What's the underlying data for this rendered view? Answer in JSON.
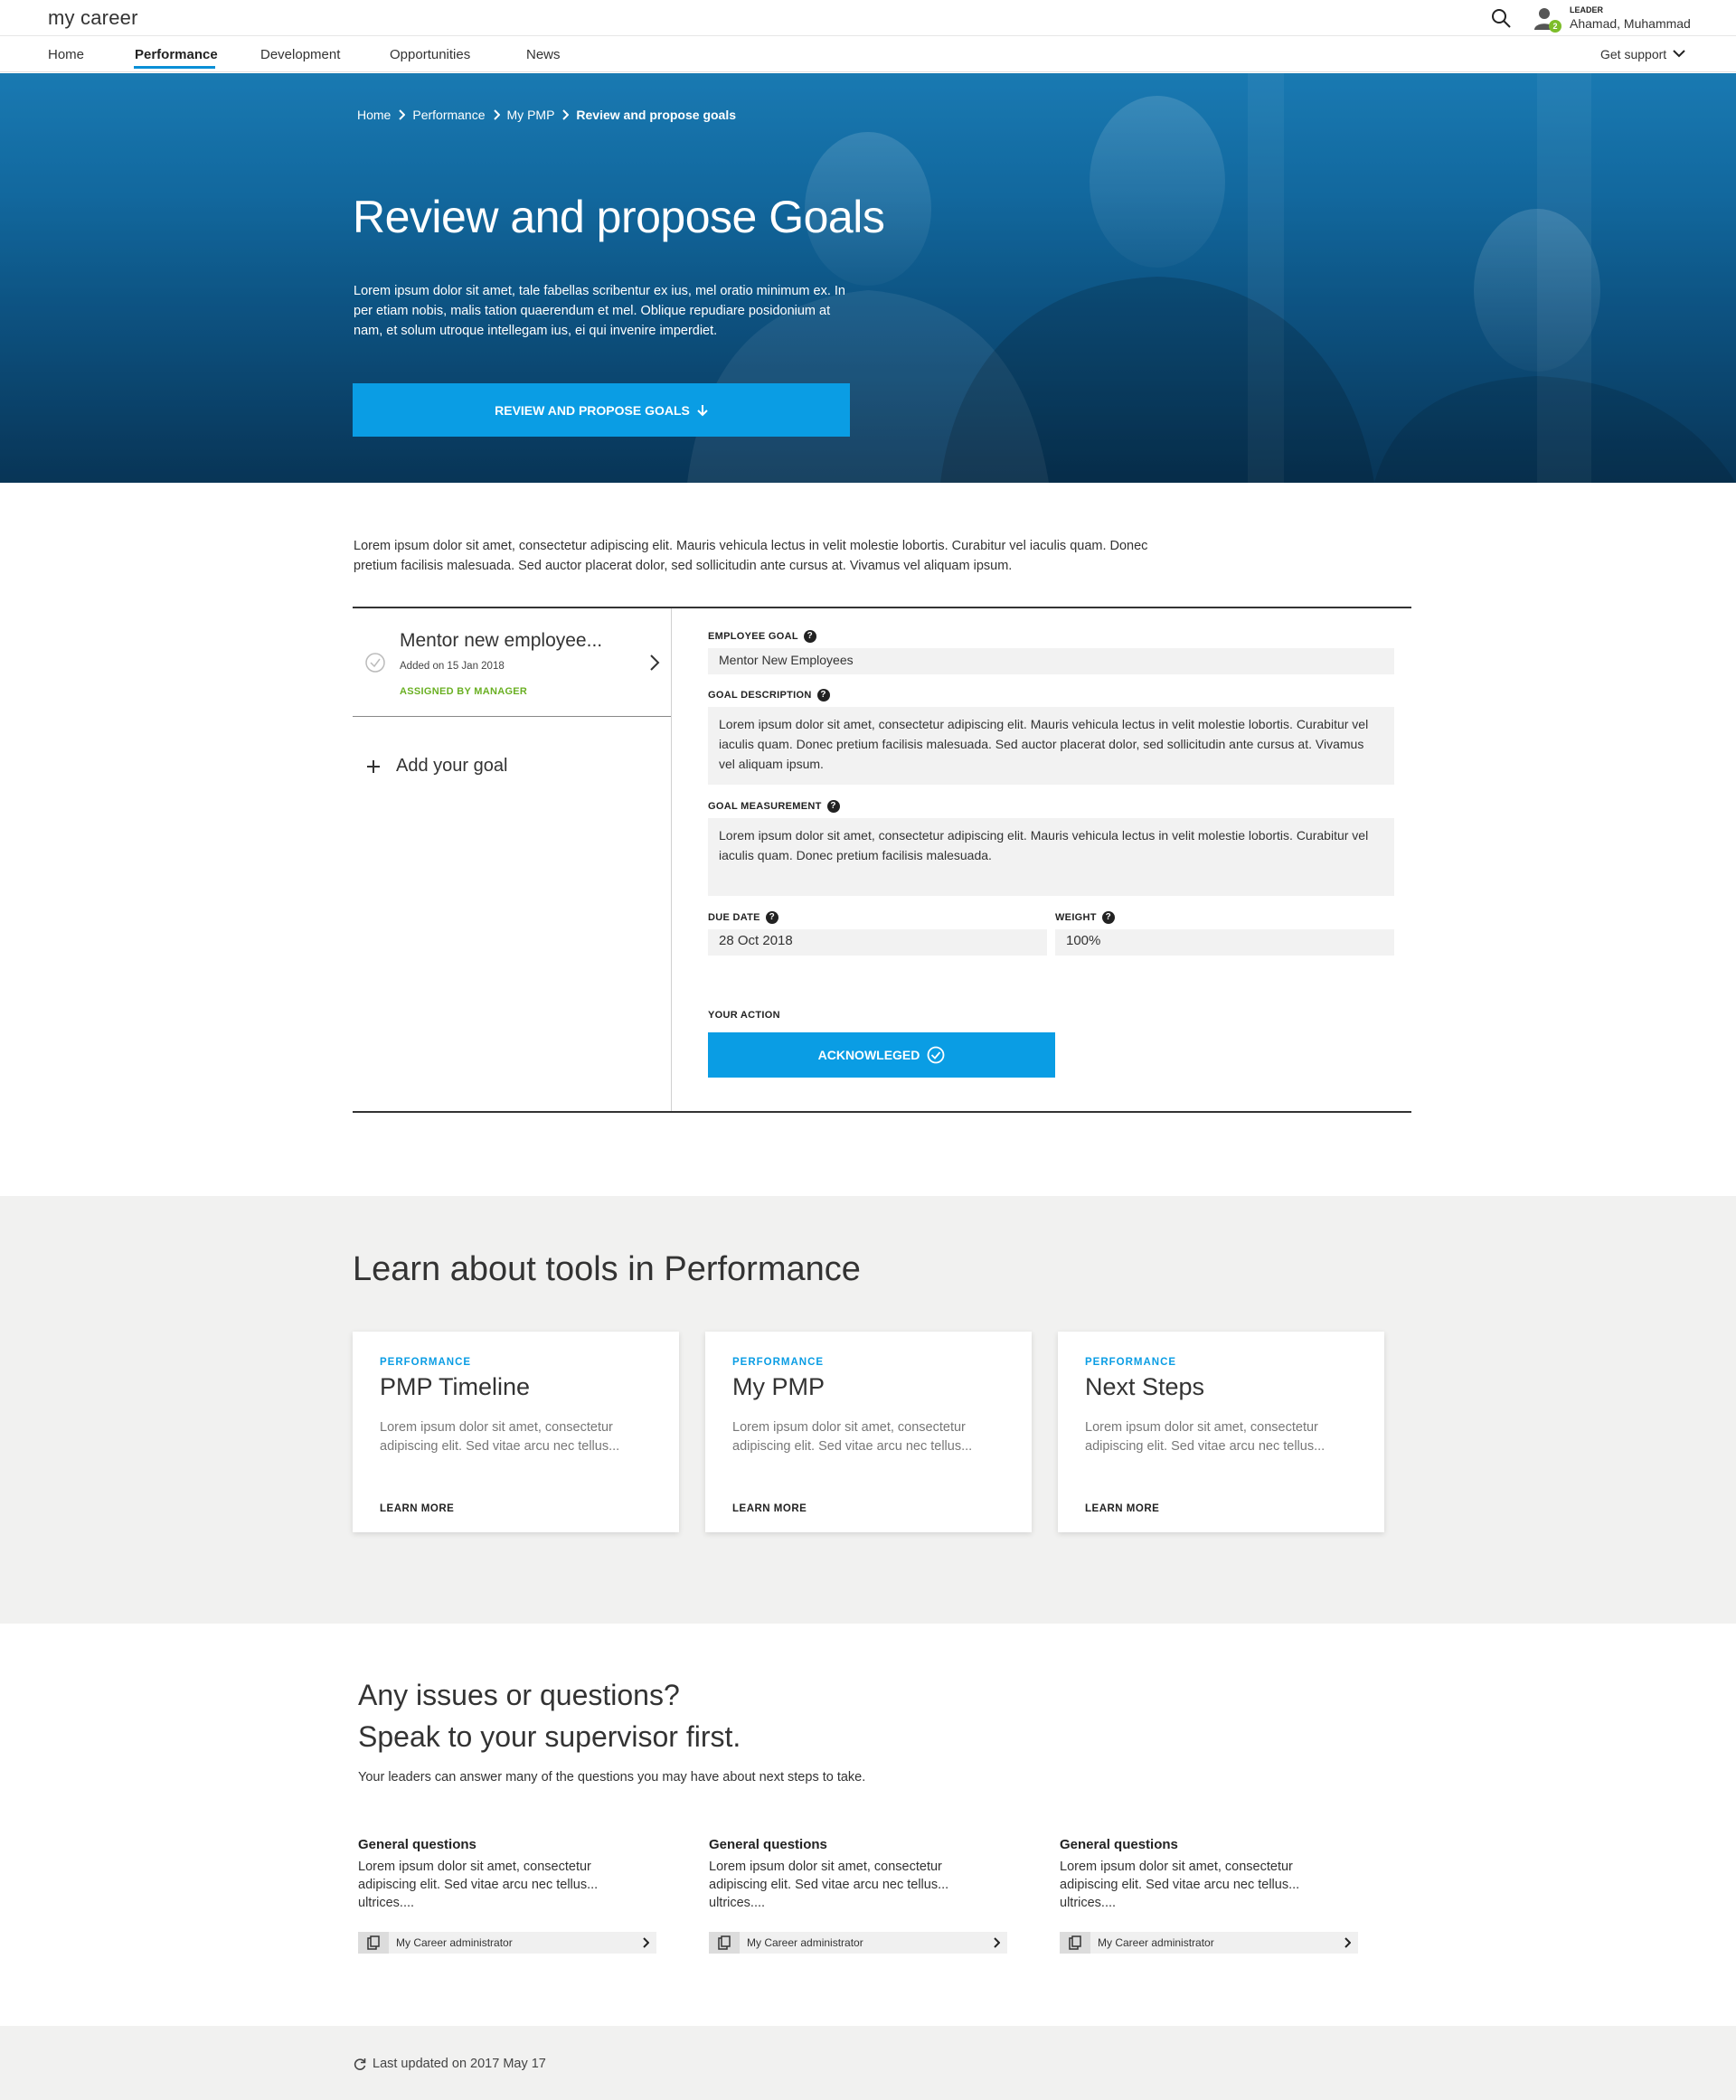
{
  "header": {
    "brand": "my career",
    "role": "LEADER",
    "user_name": "Ahamad, Muhammad",
    "notification_count": "2"
  },
  "nav": {
    "items": [
      "Home",
      "Performance",
      "Development",
      "Opportunities",
      "News"
    ],
    "active": "Performance",
    "support": "Get support"
  },
  "hero": {
    "breadcrumb": [
      "Home",
      "Performance",
      "My PMP",
      "Review and propose goals"
    ],
    "title": "Review and propose Goals",
    "description": "Lorem ipsum dolor sit amet, tale fabellas scribentur ex ius, mel oratio minimum ex. In per etiam nobis, malis tation quaerendum et mel. Oblique repudiare posidonium at nam, et solum utroque intellegam ius, ei qui invenire imperdiet.",
    "button": "REVIEW AND PROPOSE GOALS"
  },
  "intro": "Lorem ipsum dolor sit amet, consectetur adipiscing elit. Mauris vehicula lectus in velit molestie lobortis. Curabitur vel iaculis quam. Donec pretium facilisis malesuada. Sed auctor placerat dolor, sed sollicitudin ante cursus at. Vivamus vel aliquam ipsum.",
  "goals": {
    "list": [
      {
        "title": "Mentor new employee...",
        "added": "Added on 15 Jan 2018",
        "status": "ASSIGNED BY MANAGER"
      }
    ],
    "add_label": "Add your goal",
    "detail": {
      "employee_goal_label": "EMPLOYEE GOAL",
      "employee_goal": "Mentor New Employees",
      "description_label": "GOAL DESCRIPTION",
      "description": "Lorem ipsum dolor sit amet, consectetur adipiscing elit. Mauris vehicula lectus in velit molestie lobortis. Curabitur vel iaculis quam. Donec pretium facilisis malesuada. Sed auctor placerat dolor, sed sollicitudin ante cursus at. Vivamus vel aliquam ipsum.",
      "measurement_label": "GOAL MEASUREMENT",
      "measurement": "Lorem ipsum dolor sit amet, consectetur adipiscing elit. Mauris vehicula lectus in velit molestie lobortis. Curabitur vel iaculis quam. Donec pretium facilisis malesuada.",
      "due_date_label": "DUE DATE",
      "due_date": "28 Oct 2018",
      "weight_label": "WEIGHT",
      "weight": "100%",
      "action_label": "YOUR ACTION",
      "action_button": "ACKNOWLEGED"
    }
  },
  "learn": {
    "title": "Learn about tools in Performance",
    "cards": [
      {
        "kicker": "PERFORMANCE",
        "title": "PMP Timeline",
        "desc": "Lorem ipsum dolor sit amet, consectetur adipiscing elit. Sed vitae arcu nec tellus...",
        "more": "LEARN MORE"
      },
      {
        "kicker": "PERFORMANCE",
        "title": "My PMP",
        "desc": "Lorem ipsum dolor sit amet, consectetur adipiscing elit. Sed vitae arcu nec tellus...",
        "more": "LEARN MORE"
      },
      {
        "kicker": "PERFORMANCE",
        "title": "Next Steps",
        "desc": "Lorem ipsum dolor sit amet, consectetur adipiscing elit. Sed vitae arcu nec tellus...",
        "more": "LEARN MORE"
      }
    ]
  },
  "issues": {
    "title_line1": "Any issues or questions?",
    "title_line2": "Speak to your supervisor first.",
    "subtitle": "Your leaders can answer many of the questions you may have about next steps to take.",
    "columns": [
      {
        "head": "General questions",
        "text": "Lorem ipsum dolor sit amet, consectetur adipiscing elit. Sed vitae arcu nec tellus... ultrices....",
        "link": "My Career administrator"
      },
      {
        "head": "General questions",
        "text": "Lorem ipsum dolor sit amet, consectetur adipiscing elit. Sed vitae arcu nec tellus... ultrices....",
        "link": "My Career administrator"
      },
      {
        "head": "General questions",
        "text": "Lorem ipsum dolor sit amet, consectetur adipiscing elit. Sed vitae arcu nec tellus... ultrices....",
        "link": "My Career administrator"
      }
    ]
  },
  "footer": {
    "updated": "Last updated on 2017 May 17"
  },
  "colors": {
    "accent": "#0a9de4",
    "assigned": "#6ab023",
    "hero_dark": "#082e4c"
  }
}
